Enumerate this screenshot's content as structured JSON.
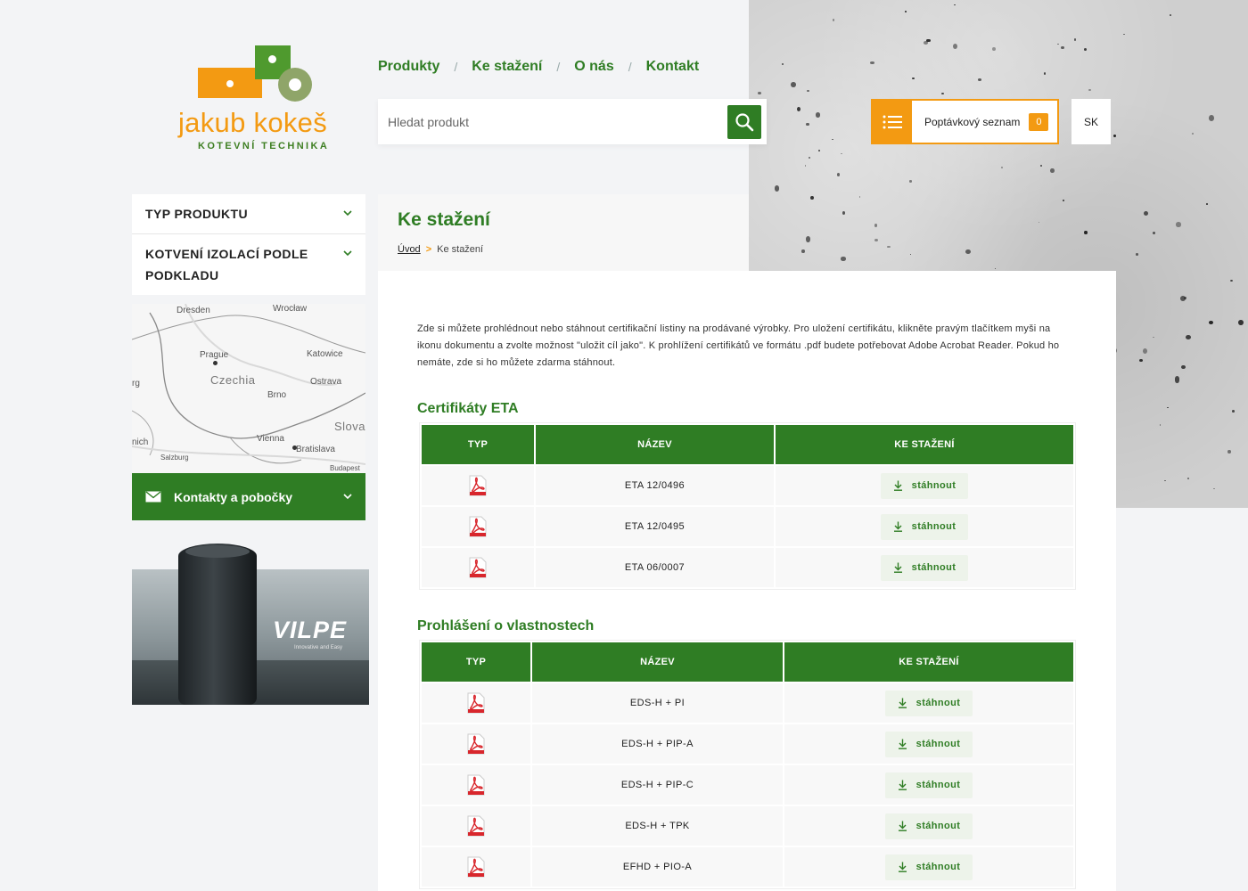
{
  "brand": {
    "name": "jakub kokeš",
    "tagline": "KOTEVNÍ TECHNIKA"
  },
  "nav": [
    {
      "label": "Produkty"
    },
    {
      "label": "Ke stažení"
    },
    {
      "label": "O nás"
    },
    {
      "label": "Kontakt"
    }
  ],
  "search": {
    "placeholder": "Hledat produkt"
  },
  "wishlist": {
    "label": "Poptávkový seznam",
    "count": "0"
  },
  "language": "SK",
  "sidebar": {
    "categories": [
      {
        "label": "TYP PRODUKTU"
      },
      {
        "label": "KOTVENÍ IZOLACÍ PODLE PODKLADU"
      }
    ],
    "map": {
      "cities": [
        "Dresden",
        "Wrocław",
        "Prague",
        "Katowice",
        "Ostrava",
        "Brno",
        "Vienna",
        "Bratislava",
        "Salzburg",
        "Budapest"
      ],
      "countries": [
        "Czechia",
        "Slova"
      ],
      "edge": [
        "rg",
        "nich"
      ]
    },
    "contacts_label": "Kontakty a pobočky",
    "banner": {
      "brand": "VILPE",
      "tagline": "Innovative and Easy"
    }
  },
  "page": {
    "title": "Ke stažení",
    "breadcrumb": {
      "home": "Úvod",
      "current": "Ke stažení"
    },
    "intro": "Zde si můžete prohlédnout nebo stáhnout certifikační listiny na prodávané výrobky. Pro uložení certifikátu, klikněte pravým tlačítkem myši na ikonu dokumentu a zvolte možnost \"uložit cíl jako\". K prohlížení certifikátů ve formátu .pdf budete potřebovat Adobe Acrobat Reader. Pokud ho nemáte, zde si ho můžete zdarma stáhnout."
  },
  "sections": [
    {
      "title": "Certifikáty ETA",
      "columns": [
        "TYP",
        "NÁZEV",
        "KE STAŽENÍ"
      ],
      "rows": [
        {
          "name": "ETA 12/0496",
          "action": "stáhnout"
        },
        {
          "name": "ETA 12/0495",
          "action": "stáhnout"
        },
        {
          "name": "ETA 06/0007",
          "action": "stáhnout"
        }
      ]
    },
    {
      "title": "Prohlášení o vlastnostech",
      "columns": [
        "TYP",
        "NÁZEV",
        "KE STAŽENÍ"
      ],
      "rows": [
        {
          "name": "EDS-H + PI",
          "action": "stáhnout"
        },
        {
          "name": "EDS-H + PIP-A",
          "action": "stáhnout"
        },
        {
          "name": "EDS-H + PIP-C",
          "action": "stáhnout"
        },
        {
          "name": "EDS-H + TPK",
          "action": "stáhnout"
        },
        {
          "name": "EFHD + PIO-A",
          "action": "stáhnout"
        }
      ]
    }
  ],
  "colors": {
    "green": "#2f7d24",
    "orange": "#f39a12",
    "pdf_red": "#d8262c"
  },
  "icons": [
    "search-icon",
    "list-icon",
    "chevron-down-icon",
    "envelope-icon",
    "pdf-icon",
    "download-icon"
  ]
}
